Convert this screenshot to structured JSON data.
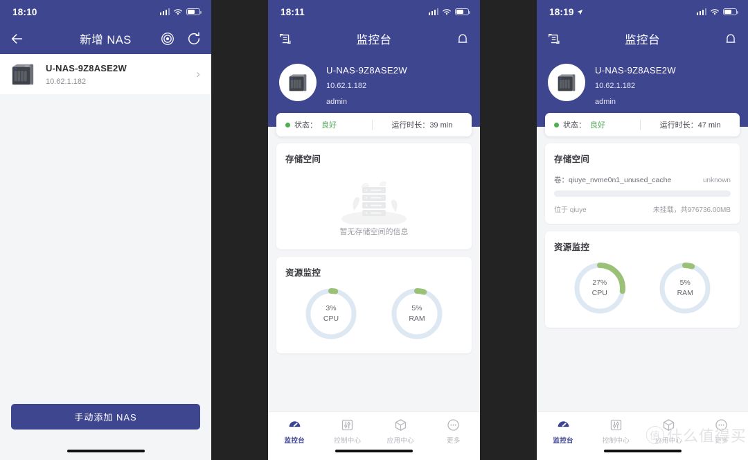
{
  "panels": [
    {
      "statusbar": {
        "time": "18:10",
        "has_location": false
      },
      "nav": {
        "title": "新增 NAS",
        "back_icon": "arrow-left-icon",
        "right_icons": [
          "radar-scan-icon",
          "refresh-icon"
        ]
      },
      "device": {
        "name": "U-NAS-9Z8ASE2W",
        "ip": "10.62.1.182",
        "icon": "nas-tower-icon"
      },
      "primary_button": "手动添加 NAS"
    },
    {
      "statusbar": {
        "time": "18:11",
        "has_location": false
      },
      "nav": {
        "title": "监控台",
        "left_icon": "device-switch-icon",
        "right_icon": "bell-icon"
      },
      "header": {
        "name": "U-NAS-9Z8ASE2W",
        "ip": "10.62.1.182",
        "user": "admin",
        "avatar_icon": "nas-tower-icon"
      },
      "status": {
        "label": "状态：",
        "value": "良好",
        "uptime_label": "运行时长：",
        "uptime": "39 min"
      },
      "storage": {
        "title": "存储空间",
        "empty_text": "暂无存储空间的信息",
        "has_volume": false
      },
      "resources": {
        "title": "资源监控",
        "gauges": [
          {
            "percent": 3,
            "value_text": "3%",
            "name": "CPU"
          },
          {
            "percent": 5,
            "value_text": "5%",
            "name": "RAM"
          }
        ]
      },
      "tabs": [
        {
          "label": "监控台",
          "icon": "gauge-icon",
          "active": true
        },
        {
          "label": "控制中心",
          "icon": "sliders-icon",
          "active": false
        },
        {
          "label": "应用中心",
          "icon": "cube-icon",
          "active": false
        },
        {
          "label": "更多",
          "icon": "ellipsis-icon",
          "active": false
        }
      ]
    },
    {
      "statusbar": {
        "time": "18:19",
        "has_location": true
      },
      "nav": {
        "title": "监控台",
        "left_icon": "device-switch-icon",
        "right_icon": "bell-icon"
      },
      "header": {
        "name": "U-NAS-9Z8ASE2W",
        "ip": "10.62.1.182",
        "user": "admin",
        "avatar_icon": "nas-tower-icon"
      },
      "status": {
        "label": "状态：",
        "value": "良好",
        "uptime_label": "运行时长：",
        "uptime": "47 min"
      },
      "storage": {
        "title": "存储空间",
        "has_volume": true,
        "volume_label": "卷：",
        "volume_name": "qiuye_nvme0n1_unused_cache",
        "volume_state": "unknown",
        "volume_fill_percent": 0,
        "located_at": "位于 qiuye",
        "size_text": "未挂载，共976736.00MB"
      },
      "resources": {
        "title": "资源监控",
        "gauges": [
          {
            "percent": 27,
            "value_text": "27%",
            "name": "CPU"
          },
          {
            "percent": 5,
            "value_text": "5%",
            "name": "RAM"
          }
        ]
      },
      "tabs": [
        {
          "label": "监控台",
          "icon": "gauge-icon",
          "active": true
        },
        {
          "label": "控制中心",
          "icon": "sliders-icon",
          "active": false
        },
        {
          "label": "应用中心",
          "icon": "cube-icon",
          "active": false
        },
        {
          "label": "更多",
          "icon": "ellipsis-icon",
          "active": false
        }
      ]
    }
  ],
  "watermark": {
    "mark": "值",
    "text": "什么值得买"
  },
  "colors": {
    "brand_blue": "#3f4690",
    "page_bg": "#f4f5f7",
    "gauge_track": "#dde8f3",
    "gauge_arc": "#9bc077",
    "status_green": "#57a85c",
    "gap": "#232323"
  }
}
